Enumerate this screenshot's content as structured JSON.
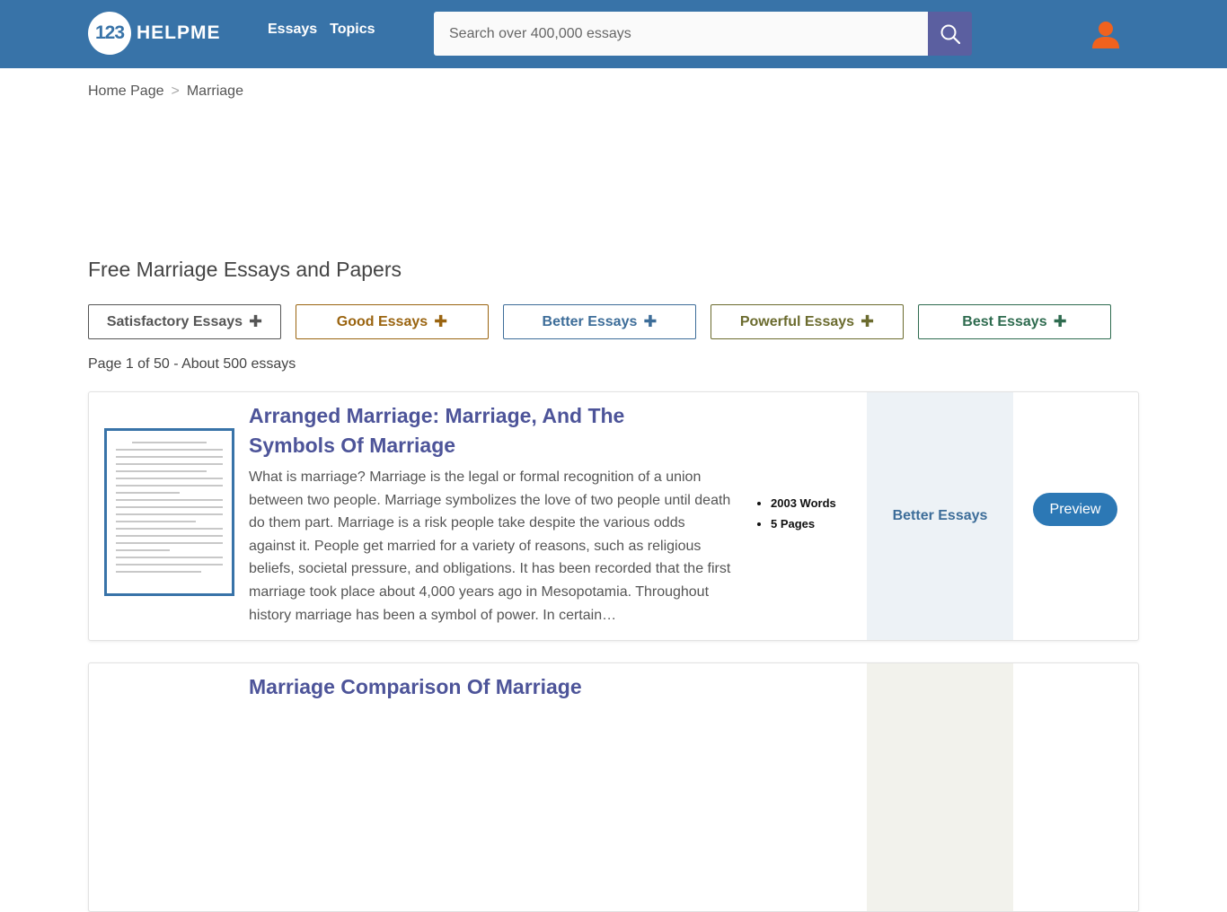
{
  "header": {
    "logo_number": "123",
    "logo_text": "HELPME",
    "nav": [
      {
        "label": "Essays"
      },
      {
        "label": "Topics"
      }
    ],
    "search": {
      "placeholder": "Search over 400,000 essays"
    }
  },
  "breadcrumb": {
    "home": "Home Page",
    "separator": ">",
    "current": "Marriage"
  },
  "page_title": "Free Marriage Essays and Papers",
  "filters": [
    {
      "label": "Satisfactory Essays",
      "color": "#555555"
    },
    {
      "label": "Good Essays",
      "color": "#9a6410"
    },
    {
      "label": "Better Essays",
      "color": "#3d6d99"
    },
    {
      "label": "Powerful Essays",
      "color": "#6b6b2e"
    },
    {
      "label": "Best Essays",
      "color": "#2e6b4f"
    }
  ],
  "filter_plus": "✚",
  "result_count": "Page 1 of 50 - About 500 essays",
  "results": [
    {
      "title": "Arranged Marriage: Marriage, And The Symbols Of Marriage",
      "description": "What is marriage? Marriage is the legal or formal recognition of a union between two people. Marriage symbolizes the love of two people until death do them part. Marriage is a risk people take despite the various odds against it. People get married for a variety of reasons, such as religious beliefs, societal pressure, and obligations. It has been recorded that the first marriage took place about 4,000 years ago in Mesopotamia. Throughout history marriage has been a symbol of power. In certain…",
      "words": "2003 Words",
      "pages": "5 Pages",
      "grade": "Better Essays",
      "preview_label": "Preview"
    },
    {
      "title": "Marriage Comparison Of Marriage",
      "description": "",
      "words": "",
      "pages": "",
      "grade": "",
      "preview_label": ""
    }
  ],
  "colors": {
    "header_bg": "#3873a8",
    "search_button": "#5b5fa0",
    "user_icon": "#f0621e",
    "title_link": "#4d5499",
    "preview_button": "#2c78b5"
  }
}
